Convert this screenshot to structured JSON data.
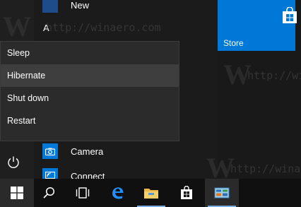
{
  "apps": [
    {
      "letter_section": "",
      "label": "New",
      "icon": "new-icon"
    },
    {
      "label": "Camera",
      "icon": "camera-icon"
    },
    {
      "label": "Connect",
      "icon": "connect-icon"
    }
  ],
  "section_letter": "A",
  "power_menu": {
    "items": [
      {
        "label": "Sleep"
      },
      {
        "label": "Hibernate",
        "highlighted": true
      },
      {
        "label": "Shut down"
      },
      {
        "label": "Restart"
      }
    ]
  },
  "tiles": {
    "store": {
      "label": "Store",
      "color": "#0078d7"
    }
  },
  "watermark": "http://winaero.com",
  "watermark_glyph": "W",
  "taskbar": {
    "items": [
      "windows-start-icon",
      "search-icon",
      "task-view-icon",
      "edge-icon",
      "file-explorer-icon",
      "store-icon",
      "control-panel-icon"
    ]
  }
}
